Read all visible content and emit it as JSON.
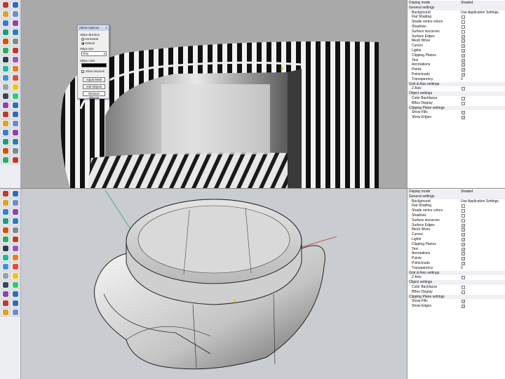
{
  "zebra_dialog": {
    "title": "Zebra Options",
    "close": "×",
    "stripe_direction_label": "Stripe direction",
    "option_horizontal": "Horizontal",
    "option_vertical": "Vertical",
    "selected_direction": "Vertical",
    "stripe_size_label": "Stripe size",
    "stripe_size_value": "Thin",
    "stripe_color_label": "Stripe color",
    "stripe_color": "#000000",
    "show_isocurve_label": "Show isocurve",
    "adjust_mesh_button": "Adjust Mesh",
    "add_objects_button": "Add Objects",
    "remove_objects_button": "Remove Objects"
  },
  "properties_panel": {
    "display_mode_label": "Display mode",
    "display_mode_value": "Shaded",
    "general_settings_label": "General settings",
    "background_label": "Background",
    "background_value": "Use Application Settings",
    "flat_shading_label": "Flat Shading",
    "shade_vertex_colors_label": "Shade vertex colors",
    "shadows_label": "Shadows",
    "surface_isocurves_label": "Surface isocurves",
    "surface_edges_label": "Surface Edges",
    "mesh_wires_label": "Mesh Wires",
    "curves_label": "Curves",
    "lights_label": "Lights",
    "clipping_planes_label": "Clipping Planes",
    "text_label": "Text",
    "annotations_label": "Annotations",
    "points_label": "Points",
    "pointclouds_label": "Pointclouds",
    "transparency_label": "Transparency",
    "transparency_value": "0",
    "grid_axis_settings_label": "Grid & Axis settings",
    "z_axis_label": "Z Axis",
    "object_settings_label": "Object settings",
    "color_backfaces_label": "Color Backfaces",
    "bbox_display_label": "BBox Display",
    "clipping_plane_settings_label": "Clipping Plane settings",
    "show_fills_label": "Show Fills",
    "show_edges_label": "Show Edges",
    "check_mark": "✓"
  },
  "toolbar_icons": [
    "select-arrow",
    "point-cloud",
    "curve-tool",
    "surface-tool",
    "circle-tool",
    "solid-box",
    "arc-tool",
    "sphere-tool",
    "rectangle-tool",
    "cylinder-tool",
    "polygon-tool",
    "cone-tool",
    "text-tool",
    "mesh-tool",
    "transform-move",
    "rotate-tool",
    "scale-tool",
    "boolean-tool",
    "fillet-tool",
    "analyze-tool",
    "dimension-tool",
    "render-tool",
    "layer-tool",
    "zebra-tool"
  ],
  "colors": {
    "toolbar_bg": "#eceef2",
    "viewport_top_bg": "#a9a9a9",
    "viewport_bottom_bg": "#c9ccd0",
    "axis_red": "#c0392b",
    "axis_green": "#27ae60",
    "section_bg": "#eef0f4"
  }
}
